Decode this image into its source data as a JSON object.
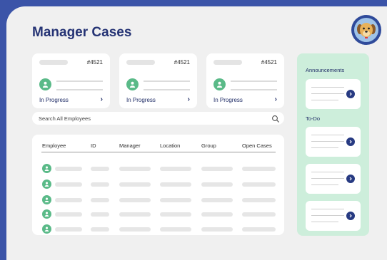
{
  "header": {
    "title": "Manager Cases"
  },
  "case_cards": [
    {
      "id": "#4521",
      "status": "In Progress"
    },
    {
      "id": "#4521",
      "status": "In Progress"
    },
    {
      "id": "#4521",
      "status": "In Progress"
    }
  ],
  "search": {
    "placeholder": "Search All Employees"
  },
  "table": {
    "columns": [
      "Employee",
      "ID",
      "Manager",
      "Location",
      "Group",
      "Open Cases"
    ],
    "row_count": 5
  },
  "panel": {
    "announcements_title": "Announcements",
    "todo_title": "To-Do"
  },
  "colors": {
    "brand_blue": "#3b54a8",
    "title_navy": "#253374",
    "accent_green": "#5aba88",
    "panel_green": "#cdeedb",
    "button_navy": "#273a82"
  },
  "icons": [
    "user-icon",
    "chevron-right-icon",
    "search-icon",
    "dog-avatar-icon"
  ]
}
